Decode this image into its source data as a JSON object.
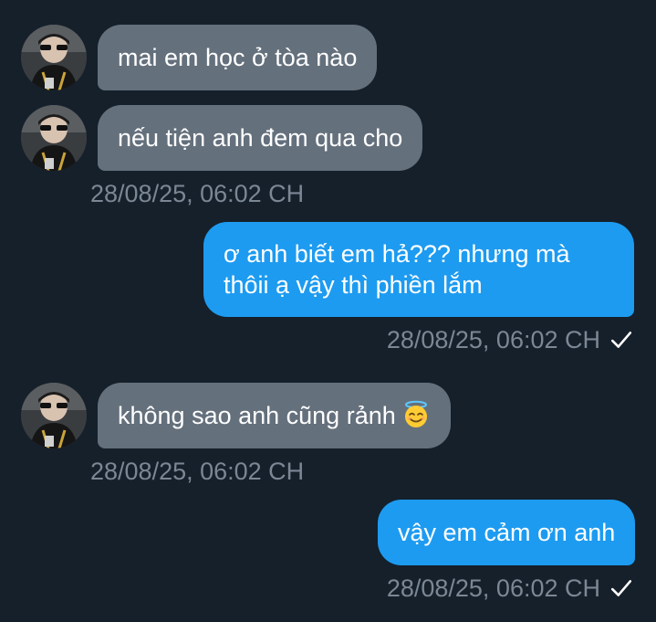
{
  "thread": {
    "messages": [
      {
        "direction": "in",
        "text": "mai em học ở tòa nào"
      },
      {
        "direction": "in",
        "text": "nếu tiện anh đem qua cho"
      },
      {
        "direction": "in_timestamp",
        "text": "28/08/25, 06:02 CH"
      },
      {
        "direction": "out",
        "lines": [
          "ơ anh biết em hả??? nhưng mà",
          "thôii ạ vậy thì phiền lắm"
        ]
      },
      {
        "direction": "out_timestamp",
        "text": "28/08/25, 06:02 CH"
      },
      {
        "direction": "in",
        "text": "không sao anh cũng rảnh",
        "emoji": "smiling-face-with-halo-icon"
      },
      {
        "direction": "in_timestamp",
        "text": "28/08/25, 06:02 CH"
      },
      {
        "direction": "out",
        "text": "vậy em cảm ơn anh"
      },
      {
        "direction": "out_timestamp",
        "text": "28/08/25, 06:02 CH"
      }
    ]
  },
  "colors": {
    "background": "#15202b",
    "incoming_bubble": "#64707c",
    "outgoing_bubble": "#1d9bf0",
    "timestamp": "#7b8794"
  }
}
